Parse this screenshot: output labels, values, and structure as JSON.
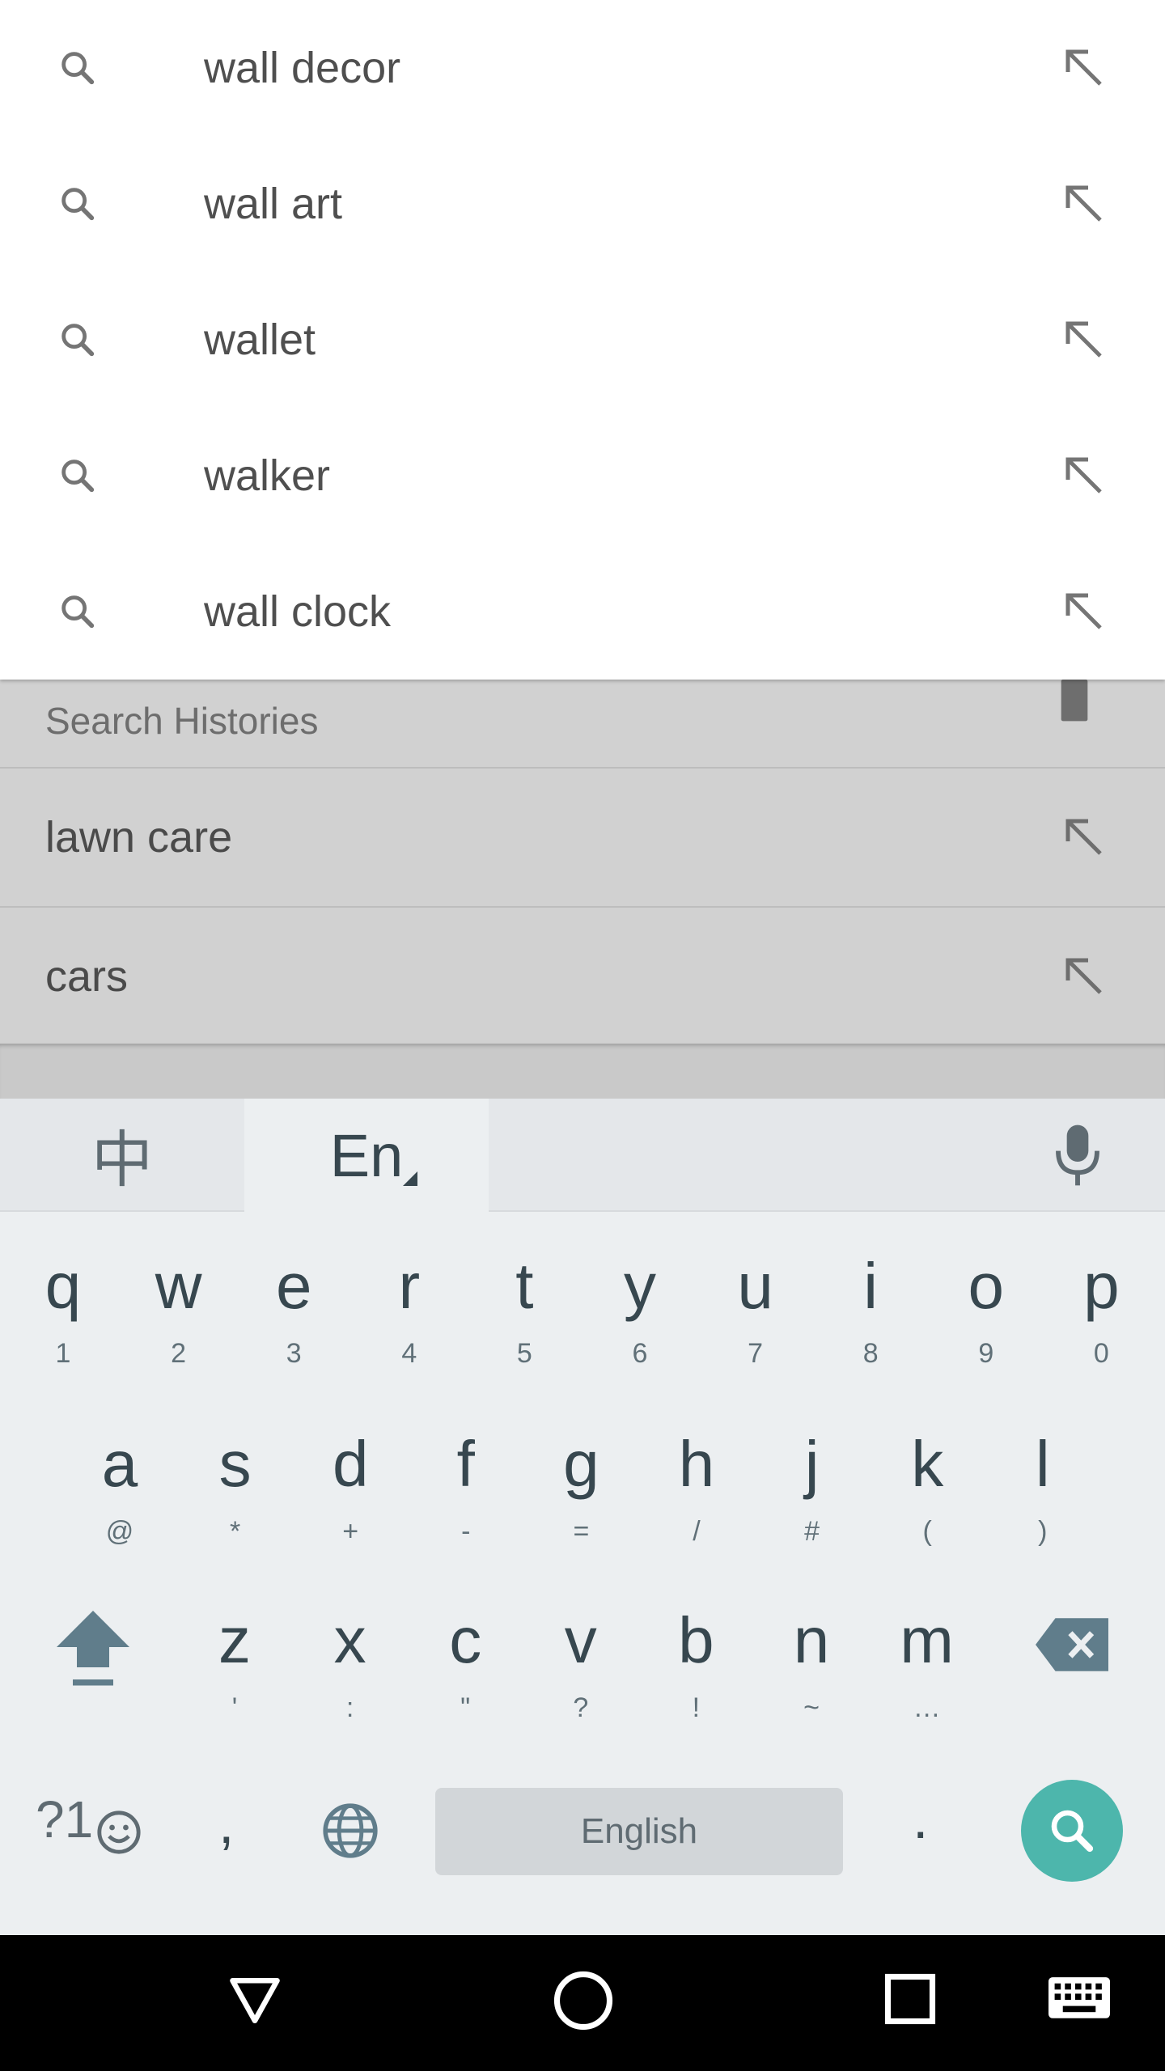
{
  "suggestions": [
    {
      "label": "wall decor"
    },
    {
      "label": "wall art"
    },
    {
      "label": "wallet"
    },
    {
      "label": "walker"
    },
    {
      "label": "wall clock"
    }
  ],
  "history": {
    "title": "Search Histories",
    "items": [
      {
        "label": "lawn care"
      },
      {
        "label": "cars"
      }
    ]
  },
  "keyboard": {
    "tab_zh": "中",
    "tab_en": "En",
    "row1": [
      {
        "main": "q",
        "sub": "1"
      },
      {
        "main": "w",
        "sub": "2"
      },
      {
        "main": "e",
        "sub": "3"
      },
      {
        "main": "r",
        "sub": "4"
      },
      {
        "main": "t",
        "sub": "5"
      },
      {
        "main": "y",
        "sub": "6"
      },
      {
        "main": "u",
        "sub": "7"
      },
      {
        "main": "i",
        "sub": "8"
      },
      {
        "main": "o",
        "sub": "9"
      },
      {
        "main": "p",
        "sub": "0"
      }
    ],
    "row2": [
      {
        "main": "a",
        "sub": "@"
      },
      {
        "main": "s",
        "sub": "*"
      },
      {
        "main": "d",
        "sub": "+"
      },
      {
        "main": "f",
        "sub": "-"
      },
      {
        "main": "g",
        "sub": "="
      },
      {
        "main": "h",
        "sub": "/"
      },
      {
        "main": "j",
        "sub": "#"
      },
      {
        "main": "k",
        "sub": "("
      },
      {
        "main": "l",
        "sub": ")"
      }
    ],
    "row3": [
      {
        "main": "z",
        "sub": "'"
      },
      {
        "main": "x",
        "sub": ":"
      },
      {
        "main": "c",
        "sub": "\""
      },
      {
        "main": "v",
        "sub": "?"
      },
      {
        "main": "b",
        "sub": "!"
      },
      {
        "main": "n",
        "sub": "~"
      },
      {
        "main": "m",
        "sub": "…"
      }
    ],
    "sym_label": "?1",
    "comma": ",",
    "space_label": "English",
    "period": "."
  },
  "colors": {
    "accent": "#4db6ac",
    "keyboard_bg": "#eceff1",
    "history_bg": "#d1d1d1"
  },
  "icons": {
    "suggestion_leading": "search-icon",
    "suggestion_trailing": "arrow-up-left-icon",
    "history_clear": "trash-icon",
    "voice": "mic-icon",
    "language": "globe-icon",
    "emoji": "smiley-icon",
    "shift": "shift-icon",
    "delete": "backspace-icon",
    "submit": "search-icon"
  }
}
